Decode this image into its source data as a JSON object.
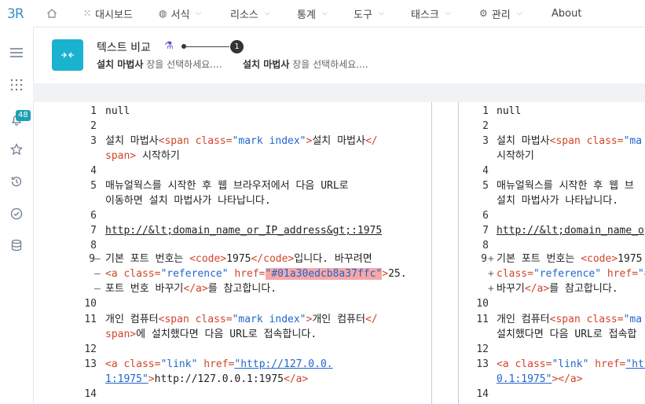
{
  "sidebar": {
    "logo": "3R",
    "badge": "48"
  },
  "nav": {
    "dashboard": "대시보드",
    "style": "서식",
    "resources": "리소스",
    "stats": "통계",
    "tools": "도구",
    "tasks": "태스크",
    "admin": "관리",
    "about": "About"
  },
  "header": {
    "title": "텍스트 비교",
    "step": "1",
    "sub_left_bold": "설치 마법사",
    "sub_left_rest": " 장을 선택하세요....",
    "sub_right_bold": "설치 마법사",
    "sub_right_rest": " 장을 선택하세요...."
  },
  "left": {
    "n1": "1",
    "n2": "2",
    "n3": "3",
    "n4": "4",
    "n5": "5",
    "n6": "6",
    "n7": "7",
    "n8": "8",
    "n9": "9",
    "n10": "10",
    "n11": "11",
    "n12": "12",
    "n13": "13",
    "n14": "14",
    "null": "null",
    "l3a_pre": "설치 마법사",
    "l3a_tag1": "<span ",
    "l3a_attr": "class=",
    "l3a_val": "\"mark index\"",
    "l3a_tag2": ">",
    "l3a_post": "설치 마법사",
    "l3a_tag3": "</",
    "l3b_tag": "span>",
    "l3b_post": " 시작하기",
    "l5a": "매뉴얼웍스를 시작한 후 웹 브라우저에서 다음 URL로",
    "l5b": "이동하면 설치 마법사가 나타납니다.",
    "l7": "http://&lt;domain_name_or_IP_address&gt;:1975",
    "l9_mark": "–",
    "l9a_pre": "기본 포트 번호는 ",
    "l9a_tag1": "<code>",
    "l9a_mid": "1975",
    "l9a_tag2": "</code>",
    "l9a_post": "입니다. 바꾸려면",
    "l9b_mark": "–",
    "l9b_tag1": "<a ",
    "l9b_attr1": "class=",
    "l9b_val1": "\"reference\"",
    "l9b_attr2": " href=",
    "l9b_val2": "\"#01a30edcb8a37ffc\"",
    "l9b_tag2": ">",
    "l9b_post": "25.",
    "l9c_mark": "–",
    "l9c_pre": "포트 번호 바꾸기",
    "l9c_tag": "</a>",
    "l9c_post": "를 참고합니다.",
    "l11a_pre": "개인 컴퓨터",
    "l11a_tag1": "<span ",
    "l11a_attr": "class=",
    "l11a_val": "\"mark index\"",
    "l11a_tag2": ">",
    "l11a_post": "개인 컴퓨터",
    "l11a_tag3": "</",
    "l11b_tag": "span>",
    "l11b_post": "에 설치했다면 다음 URL로 접속합니다.",
    "l13a_tag1": "<a ",
    "l13a_attr1": "class=",
    "l13a_val1": "\"link\"",
    "l13a_attr2": " href=",
    "l13a_val2": "\"http://127.0.0.",
    "l13b_val": "1:1975\"",
    "l13b_tag": ">",
    "l13b_post": "http://127.0.0.1:1975",
    "l13b_tag2": "</a>"
  },
  "right": {
    "null": "null",
    "l3a_pre": "설치 마법사",
    "l3a_tag1": "<span ",
    "l3a_attr": "class=",
    "l3a_val": "\"ma",
    "l3b": "시작하기",
    "l5a": "매뉴얼웍스를 시작한 후 웹 브",
    "l5b": "설치 마법사가 나타납니다.",
    "l7": "http://&lt;domain_name_o",
    "l9_mark": "+",
    "l9a_pre": "기본 포트 번호는 ",
    "l9a_tag1": "<code>",
    "l9a_mid": "1975",
    "l9b_mark": "+",
    "l9b_attr1": "class=",
    "l9b_val1": "\"reference\"",
    "l9b_attr2": " href=",
    "l9b_val2": "\"#",
    "l9c_mark": "+",
    "l9c_pre": "바꾸기",
    "l9c_tag": "</a>",
    "l9c_post": "를 참고합니다.",
    "l11a_pre": "개인 컴퓨터",
    "l11a_tag1": "<span ",
    "l11a_attr": "class=",
    "l11a_val": "\"ma",
    "l11b": "설치했다면 다음 URL로 접속합",
    "l13a_tag1": "<a ",
    "l13a_attr1": "class=",
    "l13a_val1": "\"link\"",
    "l13a_attr2": " href=",
    "l13a_val2": "\"htt",
    "l13b_val": "0.1:1975\"",
    "l13b_tag": ">",
    "l13b_tag2": "</a>"
  }
}
